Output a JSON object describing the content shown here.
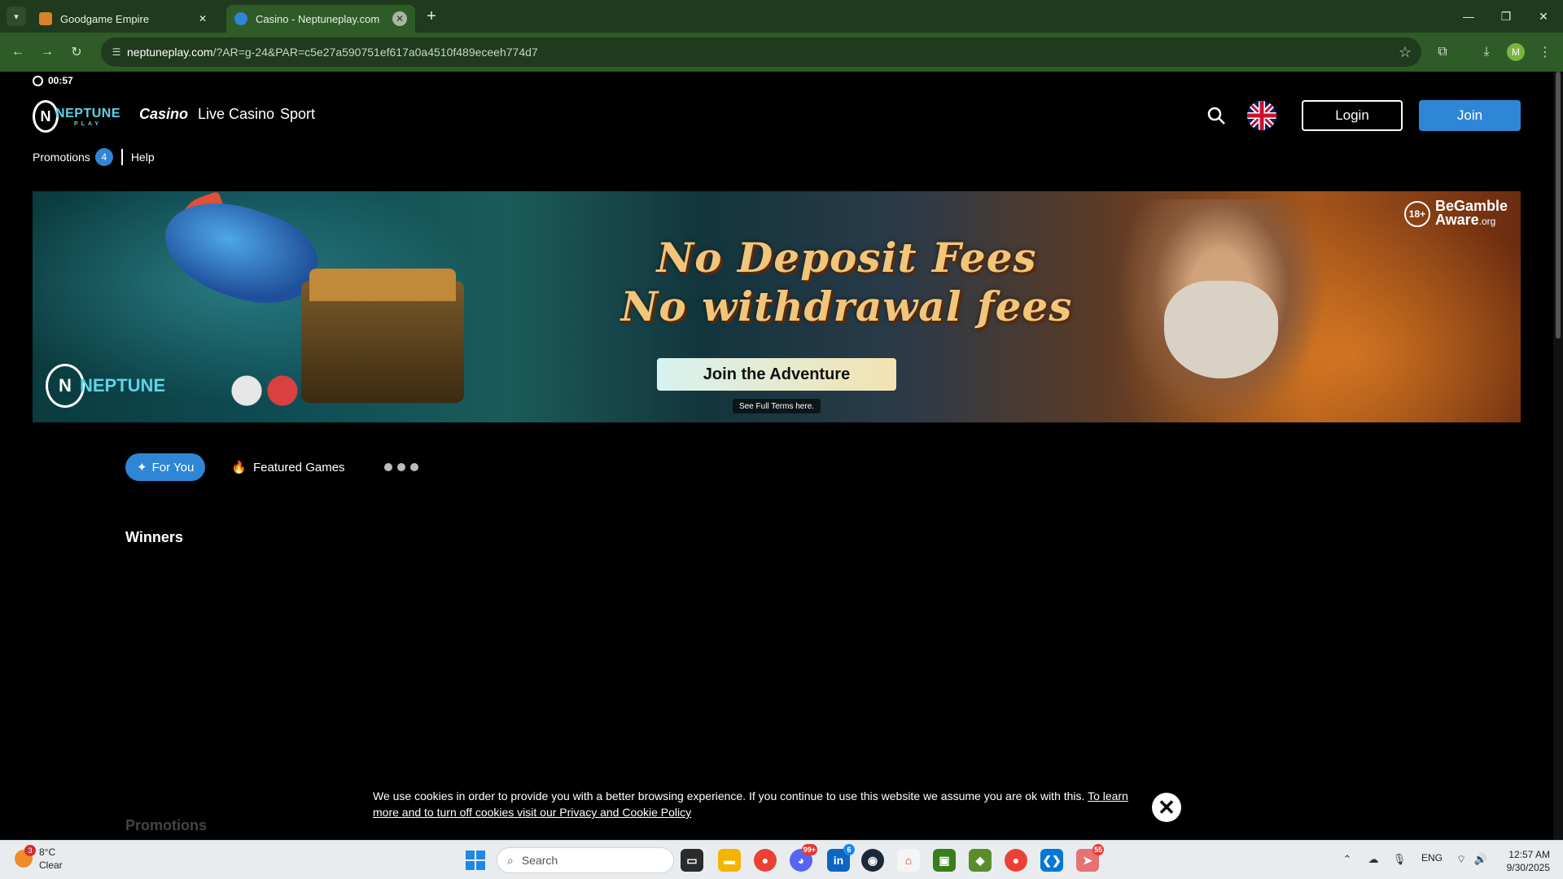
{
  "browser": {
    "tabs": [
      {
        "title": "Goodgame Empire",
        "active": false
      },
      {
        "title": "Casino - Neptuneplay.com",
        "active": true
      }
    ],
    "url_host": "neptuneplay.com",
    "url_rest": "/?AR=g-24&PAR=c5e27a590751ef617a0a4510f489eceeh774d7",
    "profile_initial": "M"
  },
  "site": {
    "clock": "00:57",
    "logo_text": "NEPTUNE",
    "logo_sub": "PLAY",
    "nav": {
      "casino": "Casino",
      "live_casino": "Live Casino",
      "sport": "Sport"
    },
    "login_label": "Login",
    "join_label": "Join",
    "subnav": {
      "promotions": "Promotions",
      "promotions_count": "4",
      "help": "Help"
    },
    "banner": {
      "line1": "No Deposit Fees",
      "line2": "No withdrawal fees",
      "cta": "Join the Adventure",
      "terms": "See Full Terms here.",
      "age": "18+",
      "gamble_aware_1": "BeGamble",
      "gamble_aware_2": "Aware",
      "gamble_aware_3": ".org",
      "logo_text": "NEPTUNE"
    },
    "tabs": {
      "for_you": "For You",
      "featured": "Featured Games"
    },
    "winners_heading": "Winners",
    "promotions_heading": "Promotions",
    "cookie": {
      "text": "We use cookies in order to provide you with a better browsing experience. If you continue to use this website we assume you are ok with this. ",
      "link": "To learn more and to turn off cookies visit our Privacy and Cookie Policy"
    }
  },
  "taskbar": {
    "weather_temp": "8°C",
    "weather_desc": "Clear",
    "weather_badge": "3",
    "search_placeholder": "Search",
    "discord_badge": "99+",
    "linkedin_badge": "6",
    "mail_badge": "55",
    "lang": "ENG",
    "time": "12:57 AM",
    "date": "9/30/2025"
  },
  "colors": {
    "accent": "#2f86d6",
    "chrome_dark": "#1f3a1c",
    "chrome_mid": "#2f5b28"
  }
}
